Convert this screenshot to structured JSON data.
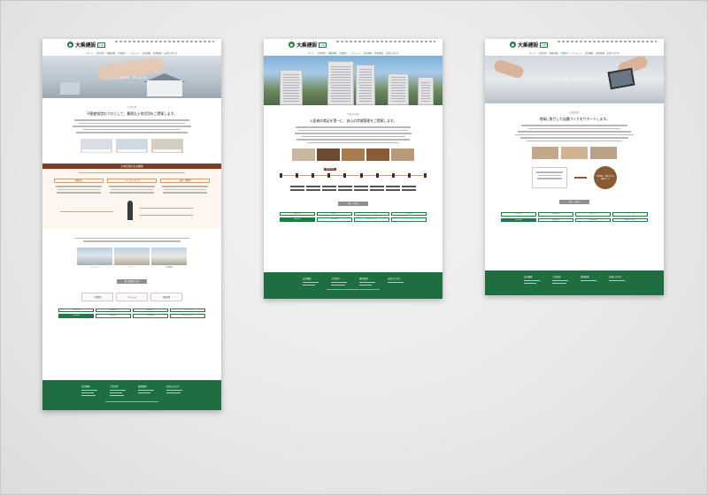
{
  "brand": {
    "name": "大乗建設",
    "badge": "LIX"
  },
  "nav": [
    "ホーム",
    "土地活用",
    "賃貸管理",
    "売買仲介",
    "リフォーム",
    "会社概要",
    "採用情報",
    "お問い合わせ"
  ],
  "pages": [
    {
      "hero_title": "LAND PLAN",
      "section_label": "土地活用",
      "section_title": "不動産経営のプロとして、最適な土地活用をご提案します。",
      "band_title": "土地活用の主な種類",
      "columns": [
        "賃貸住宅",
        "コインパーキング",
        "店舗・事業用"
      ],
      "photos": [
        "マンション",
        "アパート",
        "戸建賃貸"
      ],
      "more_button": "施工事例を見る",
      "banners": [
        "土地活用",
        "リフォーム",
        "空室対策"
      ],
      "green_buttons": [
        "土地活用",
        "賃貸管理",
        "売買仲介",
        "リフォーム",
        "会社概要",
        "資料請求",
        "採用情報",
        "お問い合わせ"
      ]
    },
    {
      "hero_title": "",
      "section_label": "不動産管理",
      "section_title": "入居者の満足を第一に、安心の賃貸管理をご提案します。",
      "timeline_tag": "管理の流れ",
      "more_button": "詳しく見る",
      "green_buttons": [
        "賃貸管理",
        "売買仲介",
        "リフォーム",
        "会社概要",
        "資料請求",
        "採用情報",
        "お問い合わせ",
        "アクセス"
      ]
    },
    {
      "hero_title": "STORE CONCEPT",
      "section_label": "店舗事業",
      "section_title": "地域に根ざした店舗づくりをサポートします。",
      "circle_text": "お客様と一緒に考える店舗づくり",
      "more_button": "詳しく見る",
      "green_buttons": [
        "土地活用",
        "賃貸管理",
        "売買仲介",
        "リフォーム",
        "会社概要",
        "資料請求",
        "採用情報",
        "お問い合わせ"
      ]
    }
  ],
  "footer": [
    "会社概要",
    "土地活用",
    "賃貸管理",
    "お問い合わせ"
  ]
}
